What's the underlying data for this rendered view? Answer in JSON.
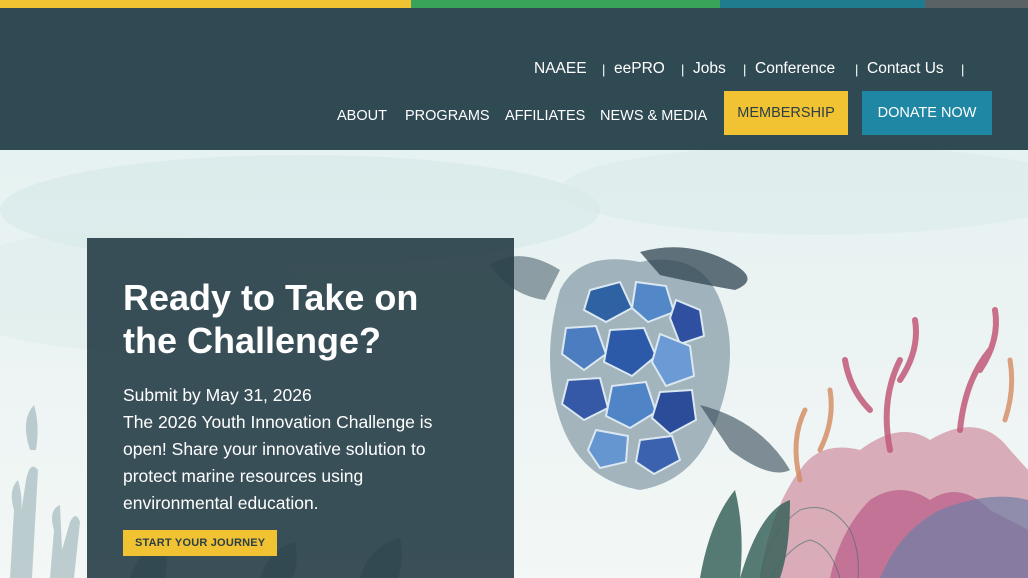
{
  "colors": {
    "strip": [
      "#f1c232",
      "#3aa35a",
      "#1f7c8f",
      "#5b6266"
    ],
    "header_bg": "#304a53",
    "accent_yellow": "#f1c232",
    "accent_blue": "#1f87a3"
  },
  "utility_nav": {
    "items": [
      {
        "label": "NAAEE"
      },
      {
        "label": "eePRO"
      },
      {
        "label": "Jobs"
      },
      {
        "label": "Conference"
      },
      {
        "label": "Contact Us"
      }
    ],
    "separator": "|"
  },
  "main_nav": {
    "items": [
      {
        "label": "ABOUT"
      },
      {
        "label": "PROGRAMS"
      },
      {
        "label": "AFFILIATES"
      },
      {
        "label": "NEWS & MEDIA"
      }
    ],
    "membership_label": "MEMBERSHIP",
    "donate_label": "DONATE NOW"
  },
  "hero": {
    "title": "Ready to Take on the Challenge?",
    "deadline": "Submit by May 31, 2026",
    "description": "The 2026 Youth Innovation Challenge is open! Share your innovative solution to protect marine resources using environmental education.",
    "cta_label": "START YOUR JOURNEY"
  }
}
